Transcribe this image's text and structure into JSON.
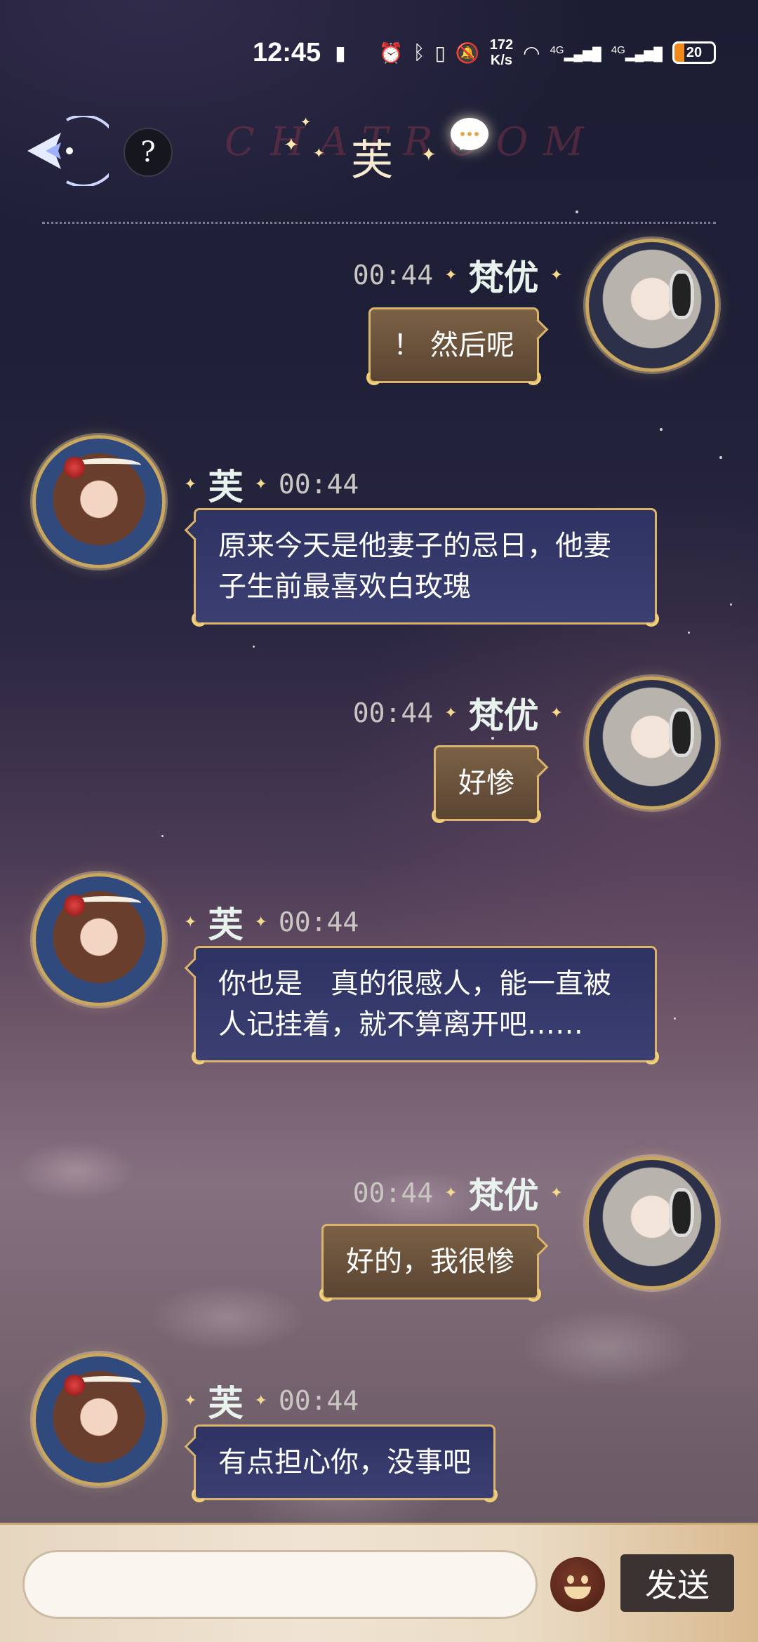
{
  "status_bar": {
    "time": "12:45",
    "net_speed_value": "172",
    "net_speed_unit": "K/s",
    "signal_label_1": "4G",
    "signal_label_2": "4G",
    "battery": "20"
  },
  "header": {
    "watermark": "CHATROOM",
    "title": "芙",
    "help_label": "?"
  },
  "messages": [
    {
      "sender": "梵优",
      "time": "00:44",
      "text": "！ 然后呢",
      "direction": "outgoing"
    },
    {
      "sender": "芙",
      "time": "00:44",
      "text": "原来今天是他妻子的忌日，他妻子生前最喜欢白玫瑰",
      "direction": "incoming"
    },
    {
      "sender": "梵优",
      "time": "00:44",
      "text": "好惨",
      "direction": "outgoing"
    },
    {
      "sender": "芙",
      "time": "00:44",
      "text": "你也是　真的很感人，能一直被人记挂着，就不算离开吧……",
      "direction": "incoming"
    },
    {
      "sender": "梵优",
      "time": "00:44",
      "text": "好的，我很惨",
      "direction": "outgoing"
    },
    {
      "sender": "芙",
      "time": "00:44",
      "text": "有点担心你，没事吧",
      "direction": "incoming"
    }
  ],
  "input": {
    "value": "",
    "send_label": "发送"
  },
  "colors": {
    "bubble_border": "#d9b46a",
    "outgoing_bubble": "#6a523c",
    "incoming_bubble": "#343870",
    "input_bar": "#eadbc4"
  }
}
